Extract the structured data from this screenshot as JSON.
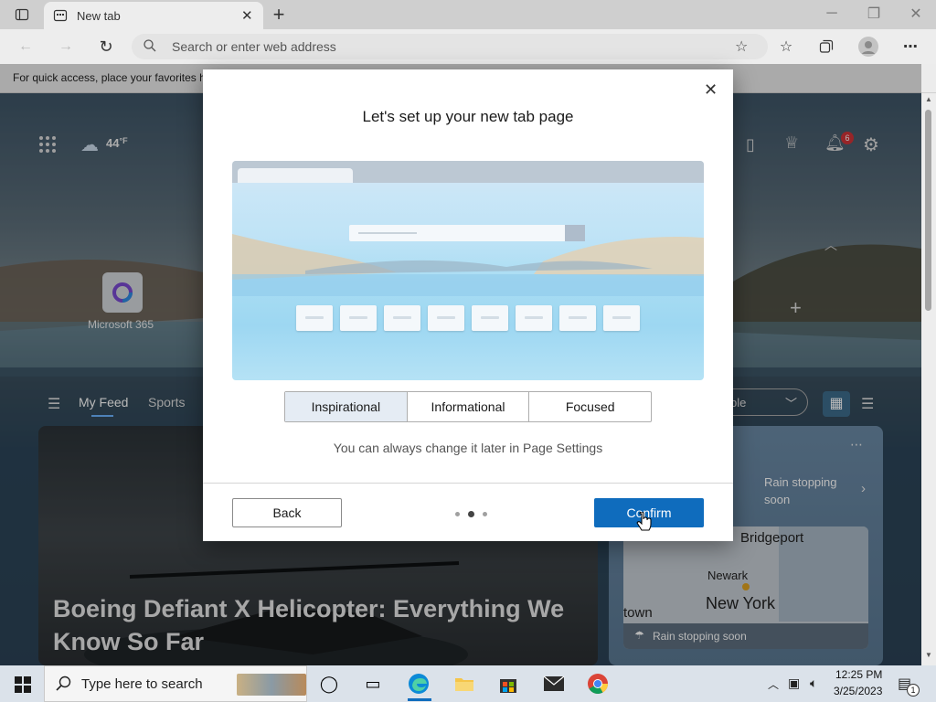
{
  "browser": {
    "tab_title": "New tab",
    "address_placeholder": "Search or enter web address",
    "favorites_bar_text": "For quick access, place your favorites here on the favorites bar."
  },
  "newtab": {
    "temperature": "44",
    "temperature_unit": "°F",
    "quick_links": [
      {
        "label": "Microsoft 365"
      }
    ],
    "feed_tabs": [
      "My Feed",
      "Sports"
    ],
    "notification_count": "6",
    "layout_select": "ble",
    "article_title": "Boeing Defiant X Helicopter: Everything We Know So Far",
    "weather_card": {
      "headline": "Rain stopping soon",
      "map_labels": [
        "Bridgeport",
        "Newark",
        "New York",
        "town"
      ],
      "footer": "Rain stopping soon"
    }
  },
  "dialog": {
    "title": "Let's set up your new tab page",
    "options": [
      "Inspirational",
      "Informational",
      "Focused"
    ],
    "selected_option": "Inspirational",
    "hint": "You can always change it later in Page Settings",
    "back_label": "Back",
    "confirm_label": "Confirm",
    "step": {
      "current": 2,
      "total": 3
    }
  },
  "taskbar": {
    "search_placeholder": "Type here to search",
    "time": "12:25 PM",
    "date": "3/25/2023",
    "notification_count": "1"
  },
  "colors": {
    "accent": "#0f6cbd",
    "notification_badge": "#d13438"
  }
}
